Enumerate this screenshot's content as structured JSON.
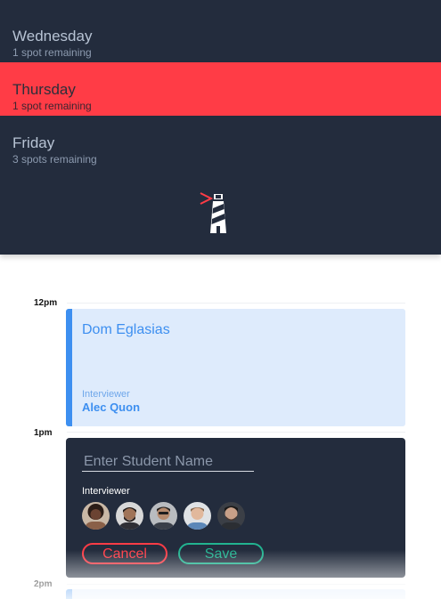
{
  "days": [
    {
      "name": "Wednesday",
      "spots": "1 spot remaining"
    },
    {
      "name": "Thursday",
      "spots": "1 spot remaining"
    },
    {
      "name": "Friday",
      "spots": "3 spots remaining"
    }
  ],
  "selected_day_index": 1,
  "logo_icon": "lighthouse-icon",
  "times": [
    "12pm",
    "1pm",
    "2pm"
  ],
  "booked_slot": {
    "student_name": "Dom Eglasias",
    "interviewer_label": "Interviewer",
    "interviewer_name": "Alec Quon"
  },
  "booking_form": {
    "student_placeholder": "Enter Student Name",
    "interviewer_label": "Interviewer",
    "interviewer_avatars": [
      "avatar-1",
      "avatar-2",
      "avatar-3",
      "avatar-4",
      "avatar-5"
    ],
    "cancel_label": "Cancel",
    "save_label": "Save"
  },
  "colors": {
    "panel": "#232c3d",
    "selected": "#ff3c46",
    "accent_blue": "#3d8ff0",
    "save_green": "#22b390"
  }
}
